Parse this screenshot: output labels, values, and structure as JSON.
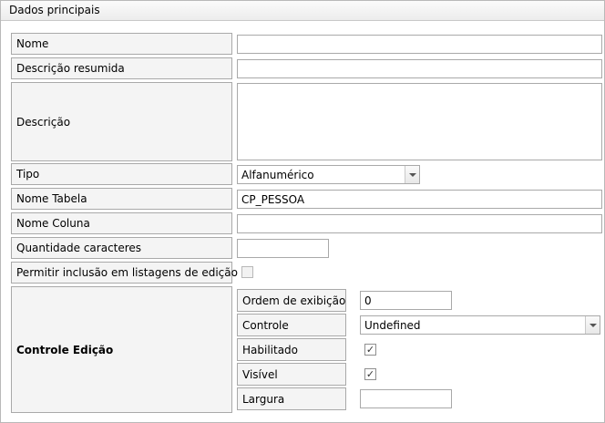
{
  "panel": {
    "title": "Dados principais"
  },
  "fields": {
    "nome": {
      "label": "Nome",
      "value": ""
    },
    "descricao_resumida": {
      "label": "Descrição resumida",
      "value": ""
    },
    "descricao": {
      "label": "Descrição",
      "value": ""
    },
    "tipo": {
      "label": "Tipo",
      "value": "Alfanumérico"
    },
    "nome_tabela": {
      "label": "Nome Tabela",
      "value": "CP_PESSOA"
    },
    "nome_coluna": {
      "label": "Nome Coluna",
      "value": ""
    },
    "quantidade_caracteres": {
      "label": "Quantidade caracteres",
      "value": ""
    },
    "permitir_inclusao": {
      "label": "Permitir inclusão em listagens de edição",
      "checked": false
    }
  },
  "controle_edicao": {
    "label": "Controle Edição",
    "ordem_exibicao": {
      "label": "Ordem de exibição",
      "value": "0"
    },
    "controle": {
      "label": "Controle",
      "value": "Undefined"
    },
    "habilitado": {
      "label": "Habilitado",
      "checked": true
    },
    "visivel": {
      "label": "Visível",
      "checked": true
    },
    "largura": {
      "label": "Largura",
      "value": ""
    }
  },
  "icons": {
    "checkmark": "✓",
    "dropdown": "chevron-down-icon"
  }
}
